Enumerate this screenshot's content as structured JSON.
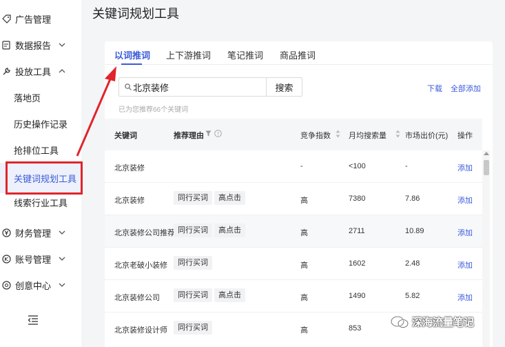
{
  "page": {
    "title": "关键词规划工具"
  },
  "sidebar": {
    "items": [
      {
        "label": "广告管理",
        "icon": "tag-icon"
      },
      {
        "label": "数据报告",
        "icon": "report-icon",
        "chevron": "down"
      },
      {
        "label": "投放工具",
        "icon": "wrench-icon",
        "chevron": "up"
      },
      {
        "label": "财务管理",
        "icon": "yen-icon",
        "chevron": "down"
      },
      {
        "label": "账号管理",
        "icon": "account-icon",
        "chevron": "down"
      },
      {
        "label": "创意中心",
        "icon": "creative-icon",
        "chevron": "down"
      }
    ],
    "subitems": [
      {
        "label": "落地页"
      },
      {
        "label": "历史操作记录"
      },
      {
        "label": "抢排位工具"
      },
      {
        "label": "关键词规划工具",
        "active": true
      },
      {
        "label": "线索行业工具"
      }
    ]
  },
  "tabs": [
    {
      "label": "以词推词",
      "active": true
    },
    {
      "label": "上下游推词"
    },
    {
      "label": "笔记推词"
    },
    {
      "label": "商品推词"
    }
  ],
  "search": {
    "value": "北京装修",
    "button_label": "搜索"
  },
  "hint": "已为您推荐66个关键词",
  "actions": {
    "download": "下载",
    "add_all": "全部添加"
  },
  "table": {
    "headers": {
      "keyword": "关键词",
      "reason": "推荐理由",
      "competition": "竞争指数",
      "monthly_search": "月均搜索量",
      "market_bid": "市场出价(元)",
      "operation": "操作"
    },
    "rows": [
      {
        "keyword": "北京装修",
        "tags": [],
        "competition": "-",
        "monthly_search": "<100",
        "market_bid": "-",
        "op": "添加"
      },
      {
        "keyword": "北京装修",
        "tags": [
          "同行买词",
          "高点击"
        ],
        "competition": "高",
        "monthly_search": "7380",
        "market_bid": "7.86",
        "op": "添加"
      },
      {
        "keyword": "北京装修公司推荐",
        "tags": [
          "同行买词",
          "高点击"
        ],
        "competition": "高",
        "monthly_search": "2711",
        "market_bid": "10.89",
        "op": "添加"
      },
      {
        "keyword": "北京老破小装修",
        "tags": [
          "同行买词"
        ],
        "competition": "高",
        "monthly_search": "1602",
        "market_bid": "2.48",
        "op": "添加"
      },
      {
        "keyword": "北京装修公司",
        "tags": [
          "同行买词",
          "高点击"
        ],
        "competition": "高",
        "monthly_search": "1490",
        "market_bid": "5.82",
        "op": "添加"
      },
      {
        "keyword": "北京装修设计师",
        "tags": [
          "同行买词"
        ],
        "competition": "高",
        "monthly_search": "853",
        "market_bid": "",
        "op": ""
      }
    ]
  },
  "watermark": "深海流量笔记",
  "colors": {
    "accent": "#3a5ad9",
    "highlight": "#e0242a"
  }
}
